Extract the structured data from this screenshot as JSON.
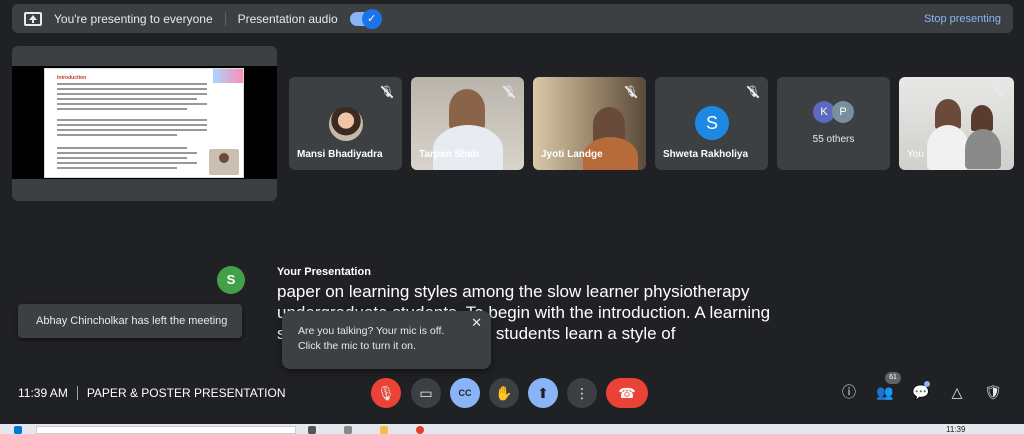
{
  "banner": {
    "presenting_text": "You're presenting to everyone",
    "audio_label": "Presentation audio",
    "audio_toggle_mark": "✓",
    "stop_label": "Stop presenting"
  },
  "presentation_slide": {
    "title": "Introduction"
  },
  "participants": [
    {
      "name": "Mansi Bhadiyadra",
      "kind": "photo-avatar"
    },
    {
      "name": "Tarpan Shah",
      "kind": "video"
    },
    {
      "name": "Jyoti Landge",
      "kind": "video"
    },
    {
      "name": "Shweta Rakholiya",
      "kind": "letter-avatar",
      "letter": "S",
      "color": "#1e88e5"
    },
    {
      "name": "55 others",
      "kind": "others",
      "letters": [
        "K",
        "P"
      ]
    },
    {
      "name": "You",
      "kind": "video"
    }
  ],
  "speaker_avatar_letter": "S",
  "left_toast": "Abhay Chincholkar has left the meeting",
  "captions": {
    "title": "Your Presentation",
    "text": "paper on learning styles among the slow learner physiotherapy undergraduate students. To begin with the introduction. A learning style is the way that different students learn a style of"
  },
  "mic_popup": {
    "line1": "Are you talking? Your mic is off.",
    "line2": "Click the mic to turn it on.",
    "close": "✕"
  },
  "footer": {
    "time": "11:39 AM",
    "meeting_name": "PAPER & POSTER PRESENTATION",
    "people_count": "61"
  },
  "controls": {
    "mic": "🎙",
    "camera": "▭",
    "captions": "CC",
    "raise_hand": "✋",
    "present": "⬆",
    "more": "⋮",
    "end_call": "☎",
    "info": "ⓘ",
    "people": "👥",
    "chat": "💬",
    "activities": "△",
    "host": "🛡"
  },
  "taskbar": {
    "time": "11:39"
  }
}
